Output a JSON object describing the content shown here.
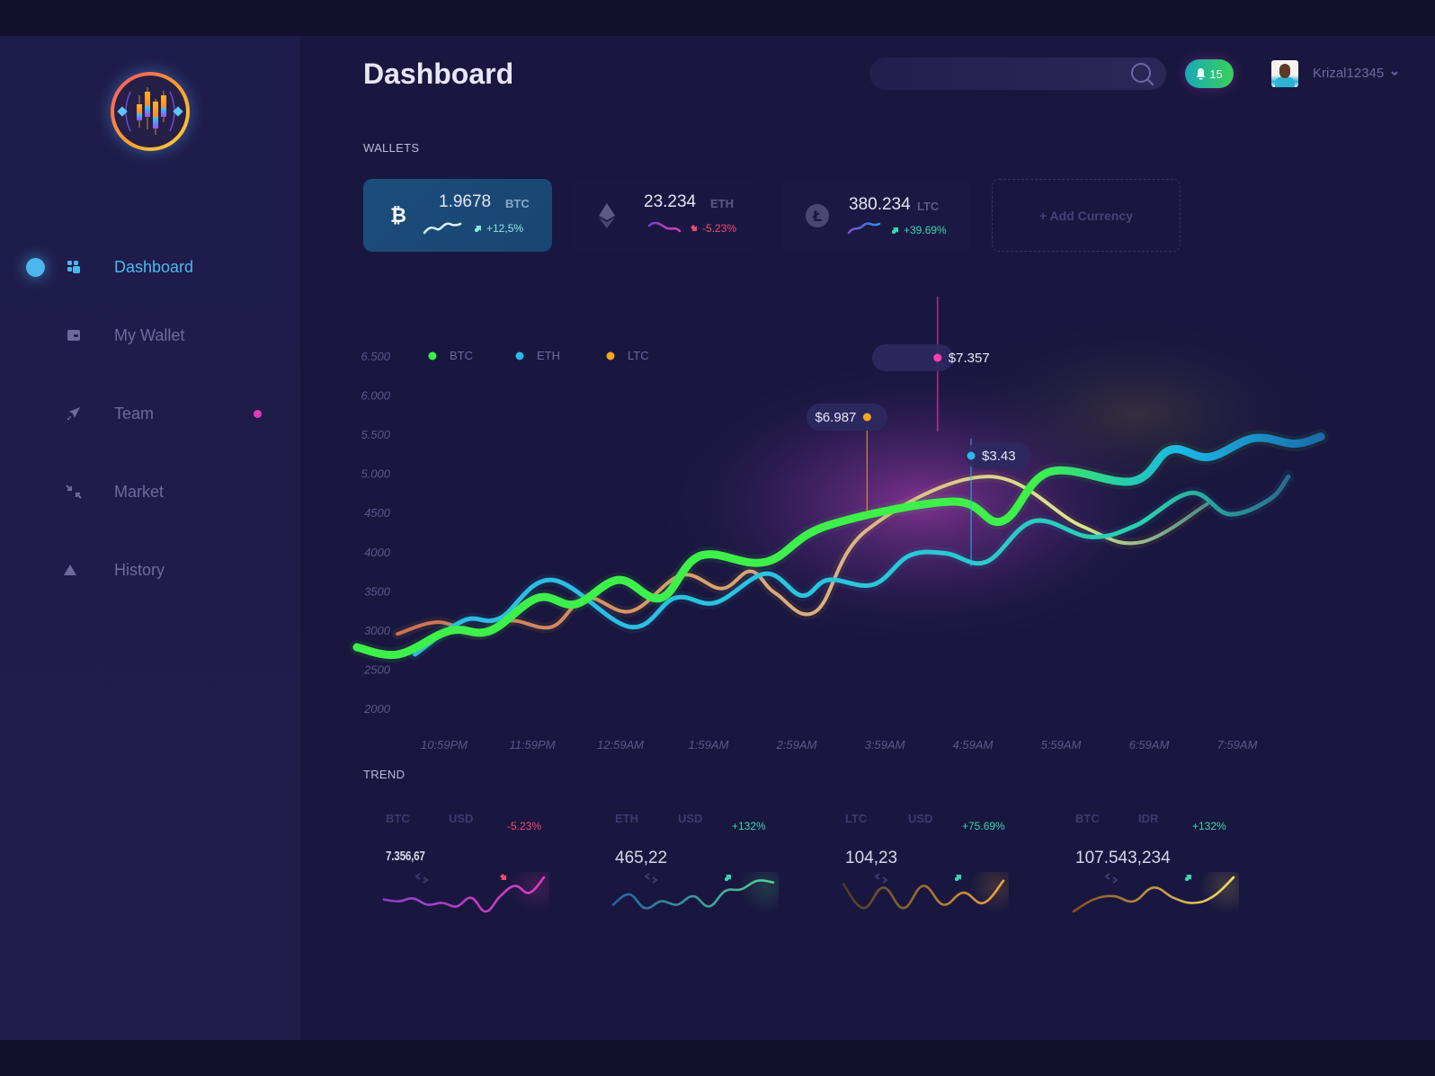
{
  "sidebar": {
    "logo": "candlestick-logo",
    "items": [
      {
        "label": "Dashboard",
        "icon": "dashboard-icon",
        "active": true
      },
      {
        "label": "My Wallet",
        "icon": "wallet-icon",
        "active": false
      },
      {
        "label": "Team",
        "icon": "paper-plane-icon",
        "active": false,
        "badge_dot": true
      },
      {
        "label": "Market",
        "icon": "arrows-collapse-icon",
        "active": false
      },
      {
        "label": "History",
        "icon": "triangle-icon",
        "active": false
      }
    ]
  },
  "header": {
    "title": "Dashboard",
    "search": {
      "value": "",
      "placeholder": ""
    },
    "notifications": {
      "count": "15"
    },
    "user": {
      "name": "Krizal12345"
    }
  },
  "wallets": {
    "label": "WALLETS",
    "items": [
      {
        "amount": "1.9678",
        "currency": "BTC",
        "change": "+12,5%",
        "direction": "up",
        "icon": "bitcoin-icon",
        "active": true
      },
      {
        "amount": "23.234",
        "currency": "ETH",
        "change": "-5.23%",
        "direction": "down",
        "icon": "ethereum-icon",
        "active": false
      },
      {
        "amount": "380.234",
        "currency": "LTC",
        "change": "+39.69%",
        "direction": "up",
        "icon": "litecoin-icon",
        "active": false
      }
    ],
    "add_label": "+ Add Currency"
  },
  "chart_data": {
    "type": "line",
    "title": "",
    "xlabel": "",
    "ylabel": "",
    "ylim": [
      2000,
      6500
    ],
    "y_ticks": [
      "6.500",
      "6.000",
      "5.500",
      "5.000",
      "4500",
      "4000",
      "3500",
      "3000",
      "2500",
      "2000"
    ],
    "y_tick_values": [
      6500,
      6000,
      5500,
      5000,
      4500,
      4000,
      3500,
      3000,
      2500,
      2000
    ],
    "x_ticks": [
      "10:59PM",
      "11:59PM",
      "12:59AM",
      "1:59AM",
      "2:59AM",
      "3:59AM",
      "4:59AM",
      "5:59AM",
      "6:59AM",
      "7:59AM"
    ],
    "x_unit": "hours since 10:59PM",
    "xlim": [
      -0.99,
      10
    ],
    "grid": false,
    "legend_position": "top-left",
    "series": [
      {
        "name": "BTC",
        "color": "#3ef04a",
        "x": [
          -0.99,
          -0.52,
          0.06,
          0.52,
          1.06,
          1.49,
          1.98,
          2.46,
          2.91,
          3.65,
          4.34,
          5.77,
          6.33,
          6.87,
          7.81,
          8.24,
          8.68,
          9.19,
          9.65,
          9.95
        ],
        "y": [
          2780,
          2690,
          2990,
          2990,
          3410,
          3330,
          3640,
          3410,
          3950,
          3870,
          4330,
          4640,
          4390,
          5020,
          4900,
          5300,
          5210,
          5450,
          5380,
          5470
        ]
      },
      {
        "name": "ETH",
        "color": "#2bb8e8",
        "x": [
          -0.33,
          0.22,
          0.63,
          1.22,
          2.11,
          2.62,
          3.08,
          3.65,
          4.06,
          4.36,
          4.87,
          5.28,
          5.69,
          6.15,
          6.69,
          7.33,
          7.84,
          8.47,
          8.91,
          9.37,
          9.58
        ],
        "y": [
          2690,
          3120,
          3150,
          3640,
          3040,
          3410,
          3350,
          3720,
          3440,
          3640,
          3580,
          3950,
          3980,
          3870,
          4390,
          4190,
          4330,
          4750,
          4480,
          4670,
          4960
        ]
      },
      {
        "name": "LTC",
        "color": "#f5a623",
        "x": [
          -0.53,
          -0.07,
          0.39,
          0.75,
          1.22,
          1.61,
          2.12,
          2.69,
          3.15,
          3.48,
          3.76,
          4.22,
          4.79,
          6.16,
          7.23,
          7.9,
          8.66
        ],
        "y": [
          2950,
          3100,
          2950,
          3120,
          3040,
          3410,
          3240,
          3700,
          3530,
          3750,
          3470,
          3240,
          4270,
          4960,
          4330,
          4120,
          4610
        ]
      }
    ],
    "annotations": [
      {
        "label": "$7.357",
        "series_color": "#ff3fb4",
        "x": 5.6
      },
      {
        "label": "$6.987",
        "series_color": "#f5a623",
        "x": 4.8
      },
      {
        "label": "$3.43",
        "series_color": "#2bb8e8",
        "x": 5.98
      }
    ]
  },
  "trend": {
    "label": "TREND",
    "items": [
      {
        "from": "BTC",
        "to": "USD",
        "change": "-5.23%",
        "direction": "down",
        "price": "7.356,67",
        "colors": [
          "#8c3fd0",
          "#e23bb8"
        ],
        "values": [
          0.35,
          0.3,
          0.38,
          0.2,
          0.25,
          0.15,
          0.4,
          0.0,
          0.45,
          0.75,
          0.55,
          1.0
        ]
      },
      {
        "from": "ETH",
        "to": "USD",
        "change": "+132%",
        "direction": "up",
        "price": "465,22",
        "colors": [
          "#2a5fa8",
          "#4fd08a"
        ],
        "values": [
          0.2,
          0.5,
          0.1,
          0.3,
          0.2,
          0.45,
          0.15,
          0.6,
          0.65,
          0.9,
          0.85
        ]
      },
      {
        "from": "LTC",
        "to": "USD",
        "change": "+75.69%",
        "direction": "up",
        "price": "104,23",
        "colors": [
          "#4a3a2a",
          "#f2a63a"
        ],
        "values": [
          0.8,
          0.1,
          0.7,
          0.1,
          0.75,
          0.2,
          0.55,
          0.25,
          0.9
        ]
      },
      {
        "from": "BTC",
        "to": "IDR",
        "change": "+132%",
        "direction": "up",
        "price": "107.543,234",
        "colors": [
          "#8a4a2a",
          "#f8e060"
        ],
        "values": [
          0.0,
          0.35,
          0.45,
          0.3,
          0.7,
          0.4,
          0.25,
          0.45,
          1.0
        ]
      }
    ]
  }
}
